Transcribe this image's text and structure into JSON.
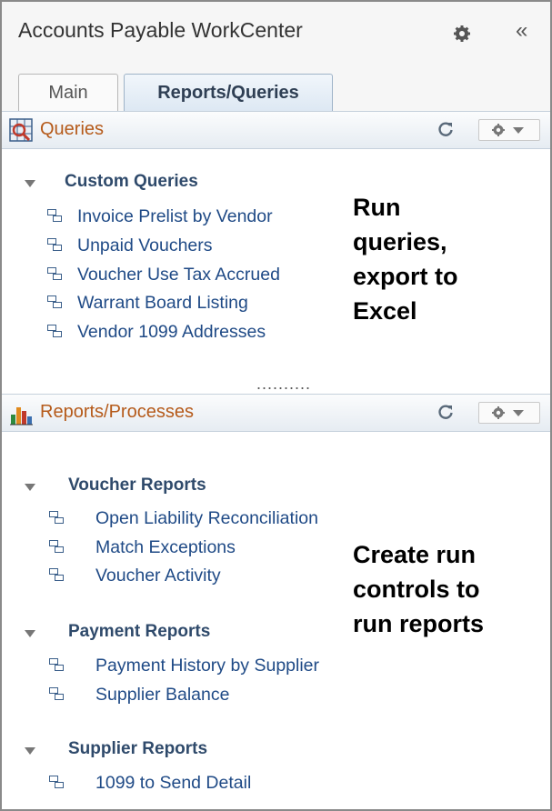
{
  "workcenter": {
    "title": "Accounts Payable WorkCenter",
    "collapse_label": "«"
  },
  "tabs": [
    {
      "label": "Main"
    },
    {
      "label": "Reports/Queries"
    }
  ],
  "queries": {
    "title": "Queries",
    "group": "Custom Queries",
    "links": [
      "Invoice Prelist by Vendor",
      "Unpaid Vouchers",
      "Voucher Use Tax Accrued",
      "Warrant Board Listing",
      "Vendor 1099 Addresses"
    ],
    "annotation": [
      "Run",
      "queries,",
      "export to",
      "Excel"
    ],
    "divider": ".........."
  },
  "reports": {
    "title": "Reports/Processes",
    "groups": [
      {
        "label": "Voucher Reports",
        "links": [
          "Open Liability Reconciliation",
          "Match Exceptions",
          "Voucher Activity"
        ]
      },
      {
        "label": "Payment Reports",
        "links": [
          "Payment History by Supplier",
          "Supplier Balance"
        ]
      },
      {
        "label": "Supplier Reports",
        "links": [
          "1099 to Send Detail"
        ]
      }
    ],
    "annotation": [
      "Create run",
      "controls to",
      "run reports"
    ]
  }
}
